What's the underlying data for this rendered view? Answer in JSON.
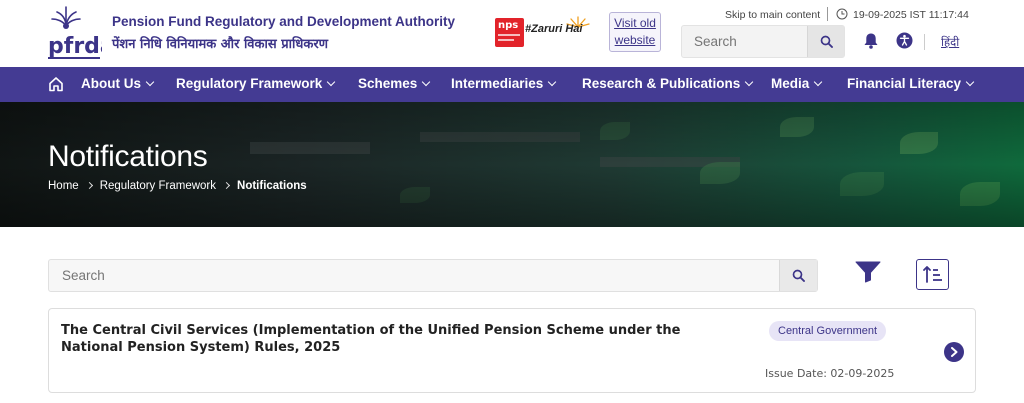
{
  "header": {
    "logo_text": "pfrda",
    "org_name_en": "Pension Fund Regulatory and Development Authority",
    "org_name_hi": "पेंशन निधि विनियामक और विकास प्राधिकरण",
    "nps_badge": "nps",
    "campaign_tag": "#Zaruri Hai",
    "visit_old_line1": "Visit old",
    "visit_old_line2": "website",
    "skip_link": "Skip to main content",
    "datetime": "19-09-2025 IST 11:17:44",
    "search_placeholder": "Search",
    "language_link": "हिंदी"
  },
  "nav": {
    "items": [
      {
        "label": "About Us"
      },
      {
        "label": "Regulatory Framework"
      },
      {
        "label": "Schemes"
      },
      {
        "label": "Intermediaries"
      },
      {
        "label": "Research & Publications"
      },
      {
        "label": "Media"
      },
      {
        "label": "Financial Literacy"
      }
    ]
  },
  "hero": {
    "title": "Notifications",
    "breadcrumb": [
      "Home",
      "Regulatory Framework",
      "Notifications"
    ]
  },
  "content": {
    "search_placeholder": "Search",
    "notifications": [
      {
        "title": "The Central Civil Services (Implementation of the Unified Pension Scheme under the National Pension System) Rules, 2025",
        "tag": "Central Government",
        "issue_date": "Issue Date: 02-09-2025"
      }
    ]
  },
  "colors": {
    "brand": "#3c3488",
    "nav_bg": "#443b93",
    "tag_bg": "#e7e4f6",
    "nps_red": "#e2232a"
  },
  "icons": [
    "pfrda-logo-icon",
    "clock-icon",
    "search-icon",
    "bell-icon",
    "accessibility-icon",
    "home-icon",
    "chevron-down-icon",
    "filter-icon",
    "sort-icon",
    "chevron-right-icon"
  ]
}
